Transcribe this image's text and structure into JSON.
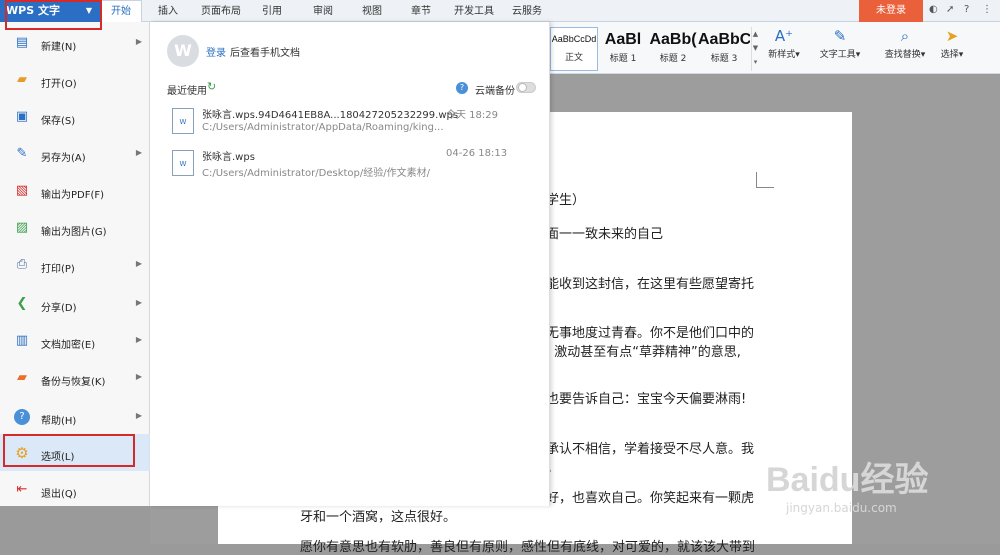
{
  "app_button": {
    "label": "WPS 文字",
    "caret": "▼"
  },
  "tabs": [
    {
      "label": "开始",
      "active": true
    },
    {
      "label": "插入"
    },
    {
      "label": "页面布局"
    },
    {
      "label": "引用"
    },
    {
      "label": "审阅"
    },
    {
      "label": "视图"
    },
    {
      "label": "章节"
    },
    {
      "label": "开发工具"
    },
    {
      "label": "云服务"
    }
  ],
  "login_button": "未登录",
  "window_icons": [
    "skin-icon",
    "share-icon",
    "help-icon"
  ],
  "window_help": "?",
  "ribbon": {
    "styles": [
      {
        "sample": "AaBbCcDd",
        "label": "正文"
      },
      {
        "sample": "AaBl",
        "label": "标题 1"
      },
      {
        "sample": "AaBb(",
        "label": "标题 2"
      },
      {
        "sample": "AaBbC",
        "label": "标题 3"
      }
    ],
    "tools": [
      {
        "label": "新样式",
        "icon": "new-style-icon"
      },
      {
        "label": "文字工具",
        "icon": "text-tools-icon"
      },
      {
        "label": "查找替换",
        "icon": "find-replace-icon"
      },
      {
        "label": "选择",
        "icon": "select-icon"
      }
    ]
  },
  "file_menu": {
    "items": [
      {
        "label": "新建(N)",
        "icon": "new-icon",
        "arrow": true
      },
      {
        "label": "打开(O)",
        "icon": "open-icon",
        "arrow": false
      },
      {
        "label": "保存(S)",
        "icon": "save-icon",
        "arrow": false
      },
      {
        "label": "另存为(A)",
        "icon": "save-as-icon",
        "arrow": true
      },
      {
        "label": "输出为PDF(F)",
        "icon": "pdf-icon",
        "arrow": false
      },
      {
        "label": "输出为图片(G)",
        "icon": "image-export-icon",
        "arrow": false
      },
      {
        "label": "打印(P)",
        "icon": "print-icon",
        "arrow": true
      },
      {
        "label": "分享(D)",
        "icon": "share-icon",
        "arrow": true
      },
      {
        "label": "文档加密(E)",
        "icon": "encrypt-icon",
        "arrow": true
      },
      {
        "label": "备份与恢复(K)",
        "icon": "backup-icon",
        "arrow": true
      },
      {
        "label": "帮助(H)",
        "icon": "help-icon",
        "arrow": true
      },
      {
        "label": "选项(L)",
        "icon": "gear-icon",
        "arrow": false,
        "selected": true
      },
      {
        "label": "退出(Q)",
        "icon": "exit-icon",
        "arrow": false
      }
    ]
  },
  "backstage": {
    "login_link": "登录",
    "login_hint": "后查看手机文档",
    "recent_title": "最近使用",
    "cloud_backup_label": "云端备份",
    "cloud_backup_on": false,
    "recent_files": [
      {
        "name": "张咏言.wps.94D4641EB8A...180427205232299.wps",
        "path": "C:/Users/Administrator/AppData/Roaming/king...",
        "time": "今天 18:29"
      },
      {
        "name": "张咏言.wps",
        "path": "C:/Users/Administrator/Desktop/经验/作文素材/",
        "time": "04-26 18:13"
      }
    ]
  },
  "document": {
    "lines": [
      "学生）",
      "面一一致未来的自己",
      "能收到这封信，在这里有些愿望寄托",
      "无事地度过青春。你不是他们口中的",
      ". 激动甚至有点“草莽精神”的意思,",
      "也要告诉自己：宝宝今天偏要淋雨!",
      "承认不相信，学着接受不尽人意。我",
      "。",
      "好，也喜欢自己。你笑起来有一颗虎",
      "牙和一个酒窝，这点很好。",
      "愿你有意思也有软肋，善良但有原则，感性但有底线，对可爱的，就该该大带到"
    ]
  },
  "watermark": {
    "brand": "Baidu经验",
    "url": "jingyan.baidu.com"
  }
}
